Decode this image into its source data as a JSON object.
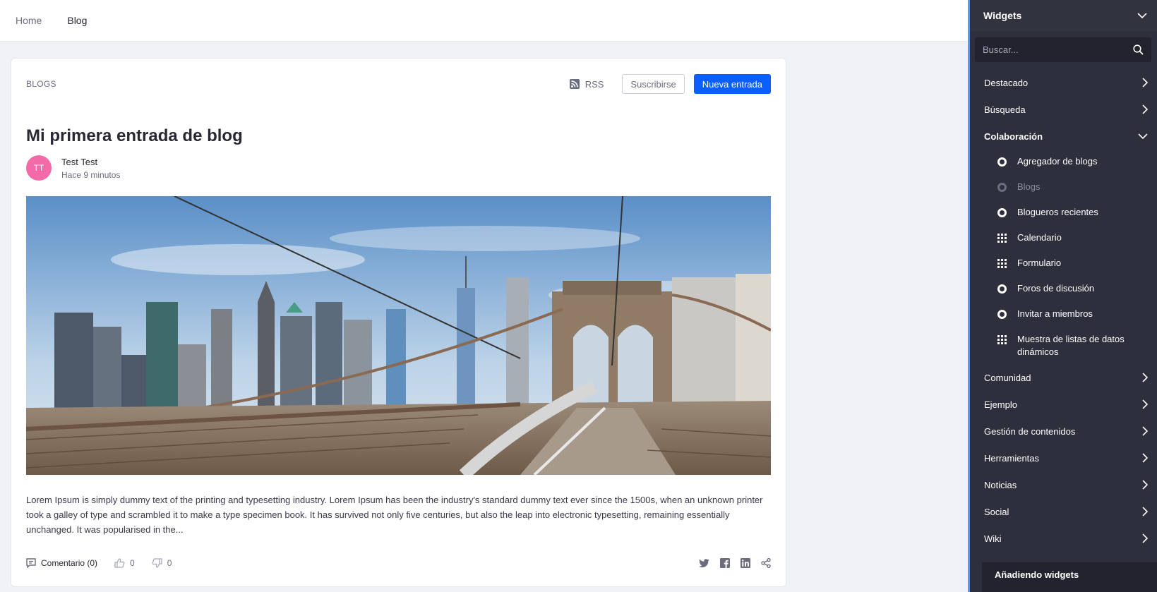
{
  "topnav": {
    "home": "Home",
    "blog": "Blog"
  },
  "card": {
    "section": "BLOGS",
    "rss": "RSS",
    "subscribe": "Suscribirse",
    "new_entry": "Nueva entrada"
  },
  "post": {
    "title": "Mi primera entrada de blog",
    "author_initials": "TT",
    "author_name": "Test Test",
    "time": "Hace 9 minutos",
    "excerpt": "Lorem Ipsum is simply dummy text of the printing and typesetting industry. Lorem Ipsum has been the industry's standard dummy text ever since the 1500s, when an unknown printer took a galley of type and scrambled it to make a type specimen book. It has survived not only five centuries, but also the leap into electronic typesetting, remaining essentially unchanged. It was popularised in the...",
    "comments": "Comentario (0)",
    "likes": "0",
    "dislikes": "0"
  },
  "sidebar": {
    "title": "Widgets",
    "search_placeholder": "Buscar...",
    "cats": [
      "Destacado",
      "Búsqueda",
      "Colaboración",
      "Comunidad",
      "Ejemplo",
      "Gestión de contenidos",
      "Herramientas",
      "Noticias",
      "Social",
      "Wiki"
    ],
    "collab_items": [
      "Agregador de blogs",
      "Blogs",
      "Blogueros recientes",
      "Calendario",
      "Formulario",
      "Foros de discusión",
      "Invitar a miembros",
      "Muestra de listas de datos dinámicos"
    ],
    "bottom": "Añadiendo widgets"
  },
  "colors": {
    "primary": "#0b5fff",
    "avatar": "#f26ba8",
    "sidebar": "#2d2f3d"
  }
}
